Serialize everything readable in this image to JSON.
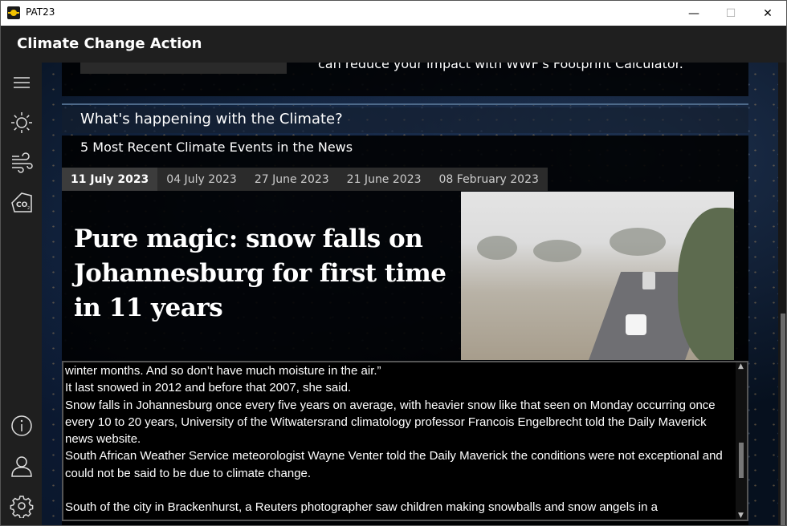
{
  "window": {
    "title": "PAT23",
    "minimize": "—",
    "maximize": "☐",
    "close": "✕"
  },
  "app": {
    "title": "Climate Change Action"
  },
  "rail": {
    "items": [
      {
        "icon": "hamburger-menu-icon"
      },
      {
        "icon": "sun-icon"
      },
      {
        "icon": "wind-icon"
      },
      {
        "icon": "co2-icon"
      },
      {
        "icon": "info-icon"
      },
      {
        "icon": "user-icon"
      },
      {
        "icon": "settings-gear-icon"
      }
    ]
  },
  "top_card": {
    "snippet": "can reduce your impact with WWF's Footprint Calculator."
  },
  "section": {
    "title": "What's happening with the Climate?"
  },
  "news": {
    "title": "5 Most Recent Climate Events in the News",
    "tabs": [
      "11 July 2023",
      "04 July 2023",
      "27 June 2023",
      "21 June 2023",
      "08 February 2023"
    ],
    "active_tab": 0,
    "headline": "Pure magic: snow falls on Johannesburg for first time in 11 years",
    "article_lines": [
      "winter months. And so don’t have much moisture in the air.”",
      "It last snowed in 2012 and before that 2007, she said.",
      "Snow falls in Johannesburg once every five years on average, with heavier snow like that seen on Monday occurring once every 10 to 20 years, University of the Witwatersrand climatology professor Francois Engelbrecht told the Daily Maverick news website.",
      "South African Weather Service meteorologist Wayne Venter told the Daily Maverick the conditions were not exceptional and could not be said to be due to climate change.",
      "",
      "South of the city in Brackenhurst, a Reuters photographer saw children making snowballs and snow angels in a"
    ]
  },
  "colors": {
    "header_bg": "#1f1f1f",
    "rail_bg": "#1f1f1f",
    "panel_bg": "#000000",
    "tab_active": "#3c3c3c",
    "tab_inactive": "#2b2b2b",
    "text": "#ffffff"
  }
}
